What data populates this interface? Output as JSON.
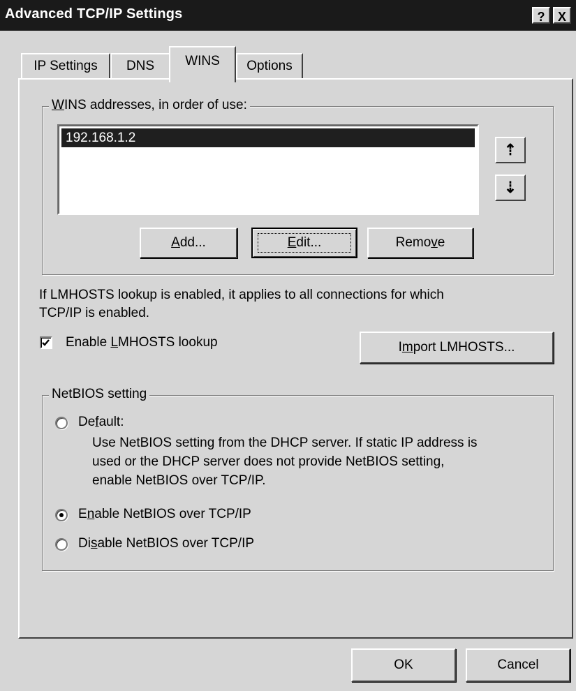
{
  "window": {
    "title": "Advanced TCP/IP Settings",
    "help_button": "?",
    "close_button": "X"
  },
  "tabs": [
    {
      "label": "IP Settings",
      "active": false
    },
    {
      "label": "DNS",
      "active": false
    },
    {
      "label": "WINS",
      "active": true
    },
    {
      "label": "Options",
      "active": false
    }
  ],
  "wins": {
    "group_label_accel": "W",
    "group_label_rest": "INS addresses, in order of use:",
    "addresses": [
      "192.168.1.2"
    ],
    "move_up_icon": "up-arrow-icon",
    "move_down_icon": "down-arrow-icon",
    "add_accel": "A",
    "add_rest": "dd...",
    "edit_accel": "E",
    "edit_rest": "dit...",
    "remove_pre": "Remo",
    "remove_accel": "v",
    "remove_post": "e"
  },
  "lmhosts": {
    "info_line1": "If LMHOSTS lookup is enabled, it applies to all connections for which",
    "info_line2": "TCP/IP is enabled.",
    "checkbox_pre": "Enable ",
    "checkbox_accel": "L",
    "checkbox_post": "MHOSTS lookup",
    "checked": true,
    "import_pre": "I",
    "import_accel": "m",
    "import_post": "port LMHOSTS..."
  },
  "netbios": {
    "group_label": "NetBIOS setting",
    "default_pre": "De",
    "default_accel": "f",
    "default_post": "ault:",
    "default_desc_line1": "Use NetBIOS setting from the DHCP server. If static IP address is",
    "default_desc_line2": "used or the DHCP server does not provide NetBIOS setting,",
    "default_desc_line3": "enable NetBIOS over TCP/IP.",
    "enable_pre": "E",
    "enable_accel": "n",
    "enable_post": "able NetBIOS over TCP/IP",
    "disable_pre": "Di",
    "disable_accel": "s",
    "disable_post": "able NetBIOS over TCP/IP",
    "selected": "enable"
  },
  "footer": {
    "ok_label": "OK",
    "cancel_label": "Cancel"
  }
}
